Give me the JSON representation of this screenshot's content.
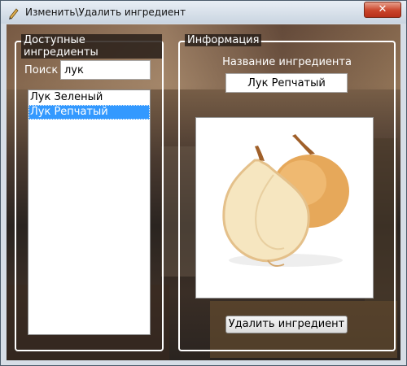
{
  "window": {
    "title": "Изменить\\Удалить ингредиент",
    "close_glyph": "✕"
  },
  "left_panel": {
    "legend": "Доступные ингредиенты",
    "search_label": "Поиск",
    "search_value": "лук",
    "items": [
      {
        "label": "Лук Зеленый",
        "selected": false
      },
      {
        "label": "Лук Репчатый",
        "selected": true
      }
    ]
  },
  "right_panel": {
    "legend": "Информация",
    "name_label": "Название ингредиента",
    "name_value": "Лук Репчатый",
    "image_subject": "onion-image",
    "delete_button": "Удалить ингредиент"
  },
  "colors": {
    "selection": "#3399ff",
    "close_button": "#c9442a"
  }
}
